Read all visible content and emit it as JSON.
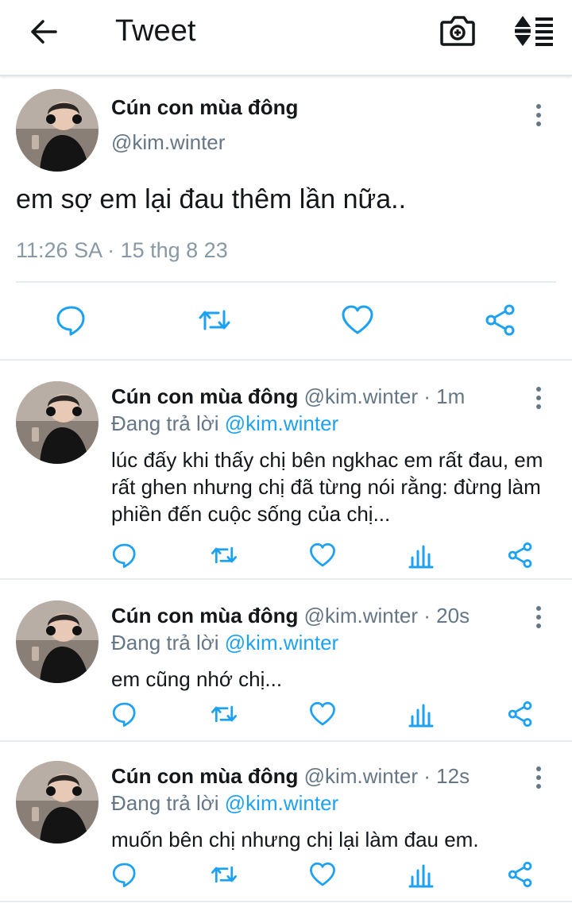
{
  "header": {
    "title": "Tweet",
    "back_icon": "arrow-left-icon",
    "camera_icon": "camera-add-icon",
    "sort_icon": "sort-list-icon"
  },
  "tweet": {
    "name": "Cún con mùa đông",
    "handle": "@kim.winter",
    "text": "em sợ em lại đau thêm lần nữa..",
    "time": "11:26 SA · 15 thg 8 23",
    "actions": [
      "reply-icon",
      "retweet-icon",
      "like-icon",
      "share-icon"
    ]
  },
  "replies": [
    {
      "name": "Cún con mùa đông",
      "meta": " @kim.winter · 1m",
      "replying_prefix": "Đang trả lời ",
      "replying_to": "@kim.winter",
      "text": "lúc đấy khi thấy chị bên ngkhac em rất đau, em rất ghen nhưng chị đã từng nói rằng: đừng làm phiền đến cuộc sống của chị..."
    },
    {
      "name": "Cún con mùa đông",
      "meta": " @kim.winter · 20s",
      "replying_prefix": "Đang trả lời ",
      "replying_to": "@kim.winter",
      "text": "em cũng nhớ chị..."
    },
    {
      "name": "Cún con mùa đông",
      "meta": " @kim.winter · 12s",
      "replying_prefix": "Đang trả lời ",
      "replying_to": "@kim.winter",
      "text": "muốn bên chị nhưng chị lại làm đau em."
    }
  ],
  "colors": {
    "accent": "#1da1f2",
    "icon": "#657786",
    "text": "#14171a",
    "muted": "#657786"
  }
}
